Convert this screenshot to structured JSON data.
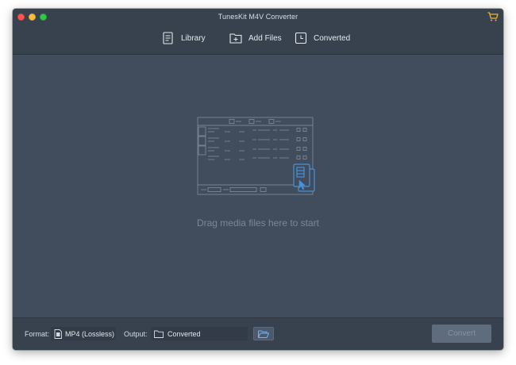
{
  "window": {
    "title": "TunesKit M4V Converter"
  },
  "toolbar": {
    "library_label": "Library",
    "add_files_label": "Add Files",
    "converted_label": "Converted"
  },
  "dropzone": {
    "hint": "Drag media files here to start"
  },
  "bottombar": {
    "format_label": "Format:",
    "format_value": "MP4 (Lossless)",
    "output_label": "Output:",
    "output_value": "Converted",
    "convert_label": "Convert"
  },
  "icons": {
    "cart": "shopping-cart-icon",
    "library": "library-list-icon",
    "add_files": "folder-plus-icon",
    "converted": "clock-icon",
    "format": "film-file-icon",
    "output_folder": "folder-icon",
    "browse": "open-folder-icon"
  },
  "colors": {
    "window_bg": "#414d5d",
    "bar_bg": "#38424f",
    "accent": "#4a90d9",
    "cart": "#f2b233"
  }
}
